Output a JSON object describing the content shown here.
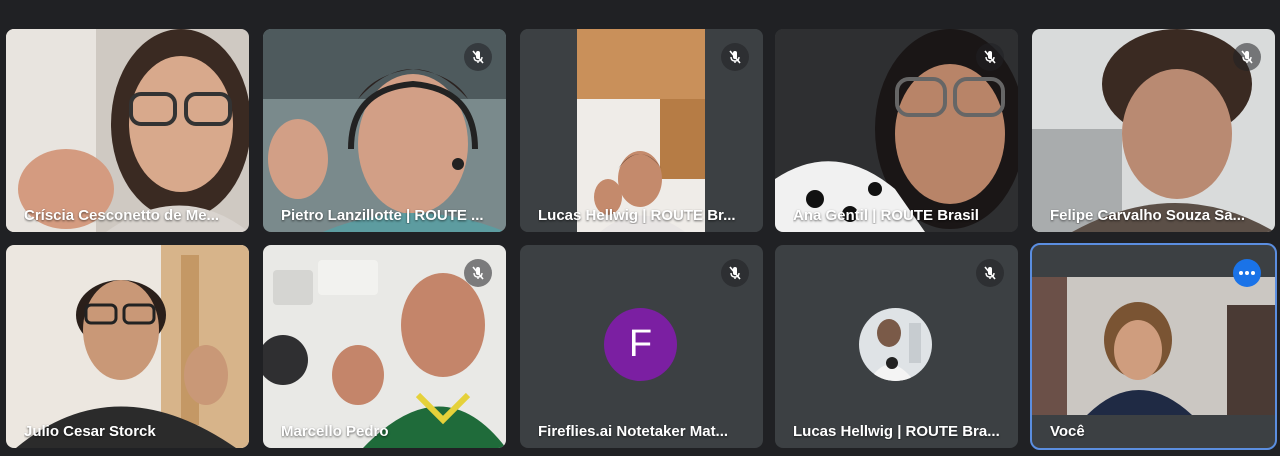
{
  "meeting": {
    "participants": [
      {
        "name": "Críscia Cesconetto de Me...",
        "muted": false
      },
      {
        "name": "Pietro Lanzillotte | ROUTE ...",
        "muted": true
      },
      {
        "name": "Lucas Hellwig | ROUTE Br...",
        "muted": true
      },
      {
        "name": "Ana Gentil | ROUTE Brasil",
        "muted": true
      },
      {
        "name": "Felipe Carvalho Souza Sa...",
        "muted": true
      },
      {
        "name": "Julio Cesar Storck",
        "muted": false
      },
      {
        "name": "Marcello Pedro",
        "muted": true
      },
      {
        "name": "Fireflies.ai Notetaker Mat...",
        "muted": true,
        "avatar_letter": "F",
        "avatar_color": "#7b1fa2"
      },
      {
        "name": "Lucas Hellwig | ROUTE Bra...",
        "muted": true
      },
      {
        "name": "Você",
        "muted": false,
        "is_self": true
      }
    ]
  },
  "colors": {
    "background": "#202124",
    "tile": "#3c4043",
    "self_outline": "#5b8ee0",
    "more_button": "#1a73e8"
  },
  "icons": {
    "mute": "mic-off-icon",
    "more": "more-options-icon"
  }
}
